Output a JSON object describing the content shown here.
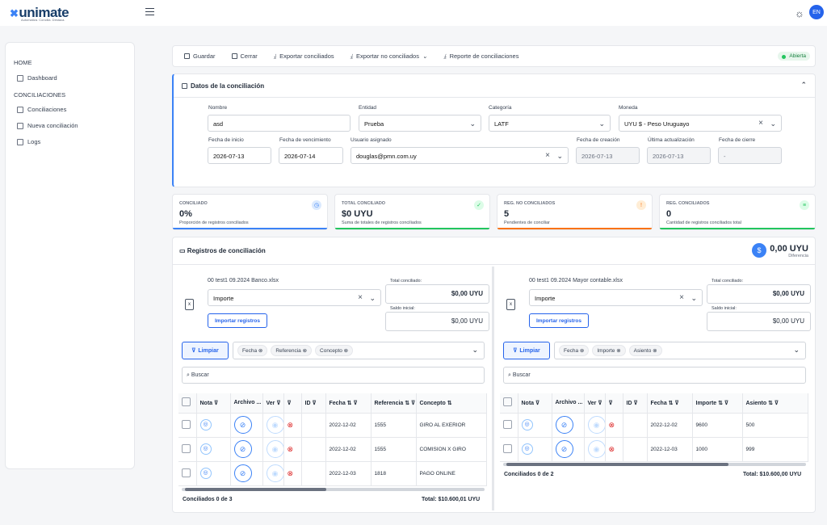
{
  "app": {
    "logo": "unimate",
    "tagline": "Automatiza. Concilia. Destaca.",
    "lang": "EN"
  },
  "sidebar": {
    "section1": "HOME",
    "dashboard": "Dashboard",
    "section2": "CONCILIACIONES",
    "items": [
      "Conciliaciones",
      "Nueva conciliación",
      "Logs"
    ]
  },
  "toolbar": {
    "guardar": "Guardar",
    "cerrar": "Cerrar",
    "exp_conc": "Exportar conciliados",
    "exp_no": "Exportar no conciliados",
    "reporte": "Reporte de conciliaciones",
    "status": "Abierta"
  },
  "datos": {
    "title": "Datos de la conciliación",
    "nombre_l": "Nombre",
    "nombre": "asd",
    "entidad_l": "Entidad",
    "entidad": "Prueba",
    "cat_l": "Categoría",
    "cat": "LATF",
    "moneda_l": "Moneda",
    "moneda": "UYU $ - Peso Uruguayo",
    "inicio_l": "Fecha de inicio",
    "inicio": "2026-07-13",
    "venc_l": "Fecha de vencimiento",
    "venc": "2026-07-14",
    "usuario_l": "Usuario asignado",
    "usuario": "douglas@pmn.com.uy",
    "creacion_l": "Fecha de creación",
    "creacion": "2026-07-13",
    "act_l": "Última actualización",
    "act": "2026-07-13",
    "cierre_l": "Fecha de cierre",
    "cierre": "-"
  },
  "stats": [
    {
      "t": "Conciliado",
      "v": "0%",
      "d": "Proporción de registros conciliados",
      "color": "#3b82f6"
    },
    {
      "t": "Total conciliado",
      "v": "$0 UYU",
      "d": "Suma de totales de registros conciliados",
      "color": "#22c55e"
    },
    {
      "t": "Reg. no conciliados",
      "v": "5",
      "d": "Pendientes de conciliar",
      "color": "#f97316"
    },
    {
      "t": "Reg. conciliados",
      "v": "0",
      "d": "Cantidad de registros conciliados total",
      "color": "#22c55e"
    }
  ],
  "regs": {
    "title": "Registros de conciliación",
    "diff": "0,00 UYU",
    "diff_l": "Diferencia"
  },
  "left": {
    "file": "00 test1 09.2024 Banco.xlsx",
    "select": "Importe",
    "import_btn": "Importar registros",
    "tot_l": "Total conciliado:",
    "tot": "$0,00 UYU",
    "saldo_l": "Saldo inicial:",
    "saldo": "$0,00 UYU",
    "limpiar": "Limpiar",
    "tags": [
      "Fecha",
      "Referencia",
      "Concepto"
    ],
    "search": "Buscar",
    "cols": [
      "Nota",
      "Archivo ...",
      "Ver",
      "",
      "ID",
      "Fecha",
      "Referencia",
      "Concepto"
    ],
    "rows": [
      [
        "2022-12-02",
        "1555",
        "GIRO AL EXERIOR"
      ],
      [
        "2022-12-02",
        "1555",
        "COMISION X GIRO"
      ],
      [
        "2022-12-03",
        "1818",
        "PAGO ONLINE"
      ]
    ],
    "footer": "Conciliados 0 de 3",
    "total": "Total: $10.600,01 UYU"
  },
  "right": {
    "file": "00 test1 09.2024 Mayor contable.xlsx",
    "select": "Importe",
    "import_btn": "Importar registros",
    "tot_l": "Total conciliado:",
    "tot": "$0,00 UYU",
    "saldo_l": "Saldo inicial:",
    "saldo": "$0,00 UYU",
    "limpiar": "Limpiar",
    "tags": [
      "Fecha",
      "Importe",
      "Asiento"
    ],
    "search": "Buscar",
    "cols": [
      "Nota",
      "Archivo ...",
      "Ver",
      "",
      "ID",
      "Fecha",
      "Importe",
      "Asiento"
    ],
    "rows": [
      [
        "2022-12-02",
        "9600",
        "500"
      ],
      [
        "2022-12-03",
        "1000",
        "999"
      ]
    ],
    "footer": "Conciliados 0 de 2",
    "total": "Total: $10.600,00 UYU"
  }
}
